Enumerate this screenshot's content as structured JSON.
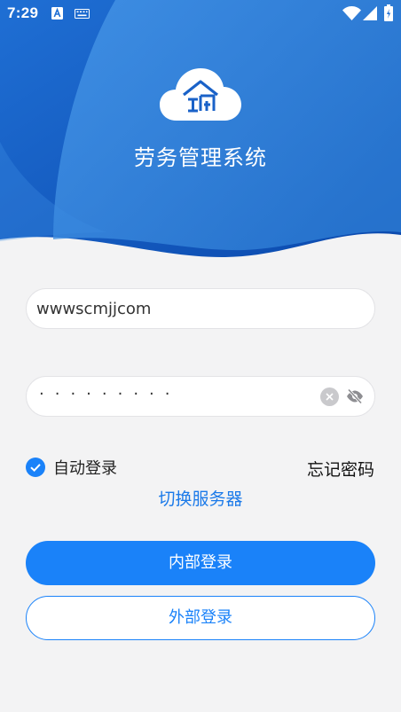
{
  "status_bar": {
    "time": "7:29",
    "icons": [
      "a-letter-notification-icon",
      "keyboard-icon",
      "wifi-icon",
      "signal-icon",
      "battery-charging-icon"
    ]
  },
  "app": {
    "title": "劳务管理系统",
    "logo": "cloud-house-logo"
  },
  "login_form": {
    "username_value": "wwwscmjjcom",
    "password_masked": "·········",
    "clear_icon": "clear-icon",
    "visibility_icon": "eye-off-icon",
    "remember_label": "自动登录",
    "remember_checked": true,
    "forgot_label": "忘记密码",
    "switch_server_label": "切换服务器",
    "internal_login_label": "内部登录",
    "external_login_label": "外部登录"
  },
  "colors": {
    "primary": "#1a82f9",
    "hero_dark": "#0f52b8",
    "hero_light": "#2f83dc",
    "background": "#f3f3f4"
  }
}
